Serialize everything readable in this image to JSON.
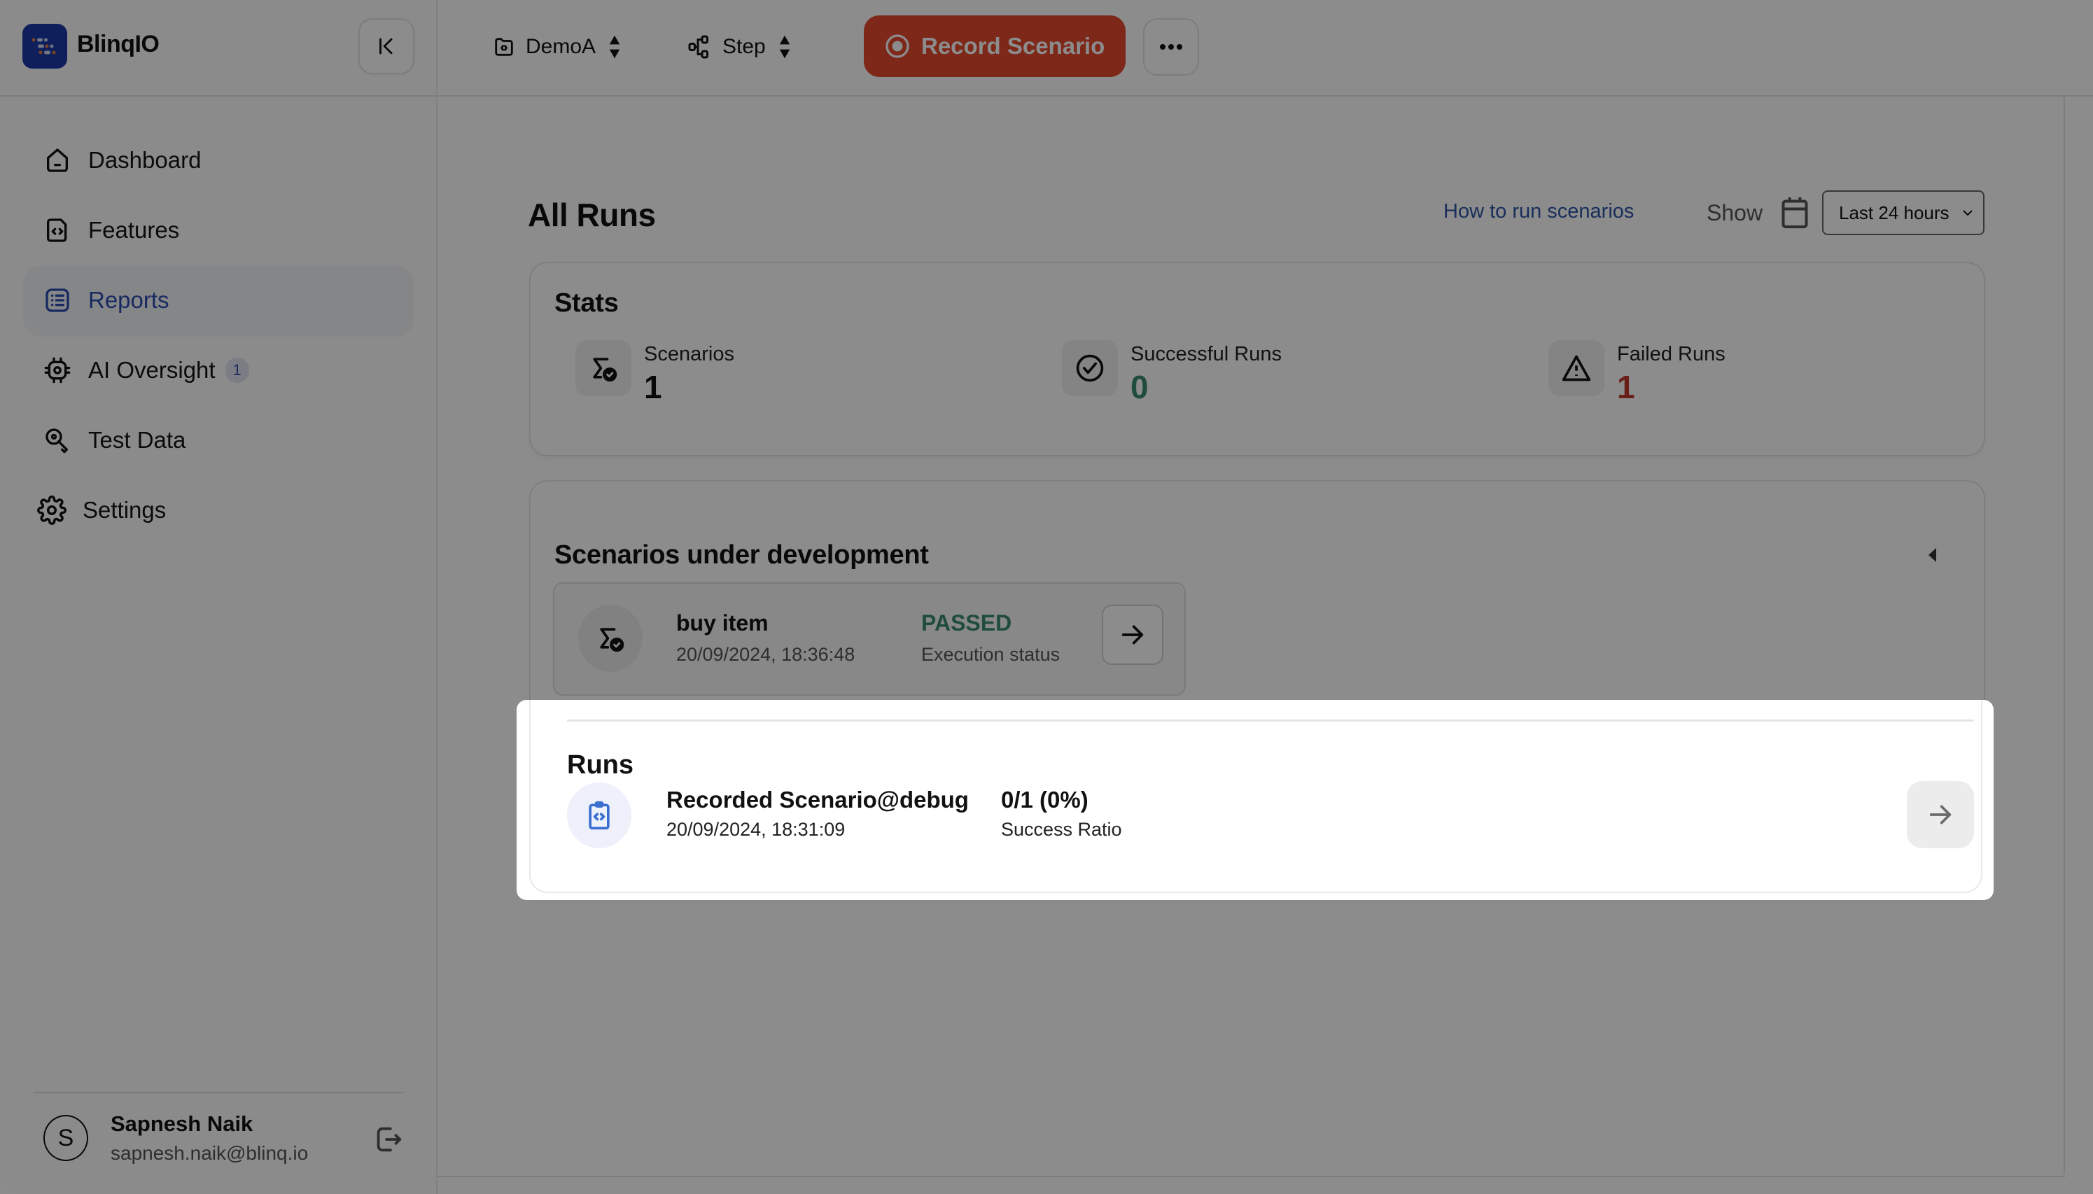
{
  "app": {
    "name": "BlinqIO",
    "brand_color": "#1a3aa8",
    "accent_color": "#2a4bb0"
  },
  "topbar": {
    "project_selector": {
      "label": "DemoA",
      "icon": "folder-code-icon"
    },
    "mode_selector": {
      "label": "Step",
      "icon": "workflow-icon"
    },
    "record_button": {
      "label": "Record Scenario",
      "icon": "record-icon",
      "color": "#e64a2e"
    },
    "more_button": {
      "icon": "more-horizontal-icon"
    }
  },
  "sidebar": {
    "collapse_icon": "collapse-left-icon",
    "items": [
      {
        "label": "Dashboard",
        "icon": "home-icon",
        "active": false
      },
      {
        "label": "Features",
        "icon": "file-code-icon",
        "active": false
      },
      {
        "label": "Reports",
        "icon": "list-icon",
        "active": true
      },
      {
        "label": "AI Oversight",
        "icon": "cpu-icon",
        "active": false,
        "badge": "1"
      },
      {
        "label": "Test Data",
        "icon": "key-icon",
        "active": false
      },
      {
        "label": "Settings",
        "icon": "gear-icon",
        "active": false
      }
    ],
    "user": {
      "initial": "S",
      "name": "Sapnesh Naik",
      "email": "sapnesh.naik@blinq.io",
      "logout_icon": "logout-icon"
    }
  },
  "main": {
    "title": "All Runs",
    "help_link": "How to run scenarios",
    "show_label": "Show",
    "time_range": {
      "selected": "Last 24 hours"
    },
    "stats": {
      "title": "Stats",
      "items": [
        {
          "label": "Scenarios",
          "value": "1",
          "icon": "sigma-check-icon",
          "color": "#111111"
        },
        {
          "label": "Successful Runs",
          "value": "0",
          "icon": "check-circle-icon",
          "color": "#3b8a72"
        },
        {
          "label": "Failed Runs",
          "value": "1",
          "icon": "warning-icon",
          "color": "#c0392b"
        }
      ]
    },
    "scenarios_under_development": {
      "title": "Scenarios under development",
      "items": [
        {
          "name": "buy item",
          "timestamp": "20/09/2024, 18:36:48",
          "status": "PASSED",
          "status_label": "Execution status",
          "status_color": "#3b8a72"
        }
      ]
    },
    "runs": {
      "title": "Runs",
      "items": [
        {
          "name": "Recorded Scenario@debug",
          "timestamp": "20/09/2024, 18:31:09",
          "ratio": "0/1 (0%)",
          "ratio_label": "Success Ratio"
        }
      ]
    }
  }
}
